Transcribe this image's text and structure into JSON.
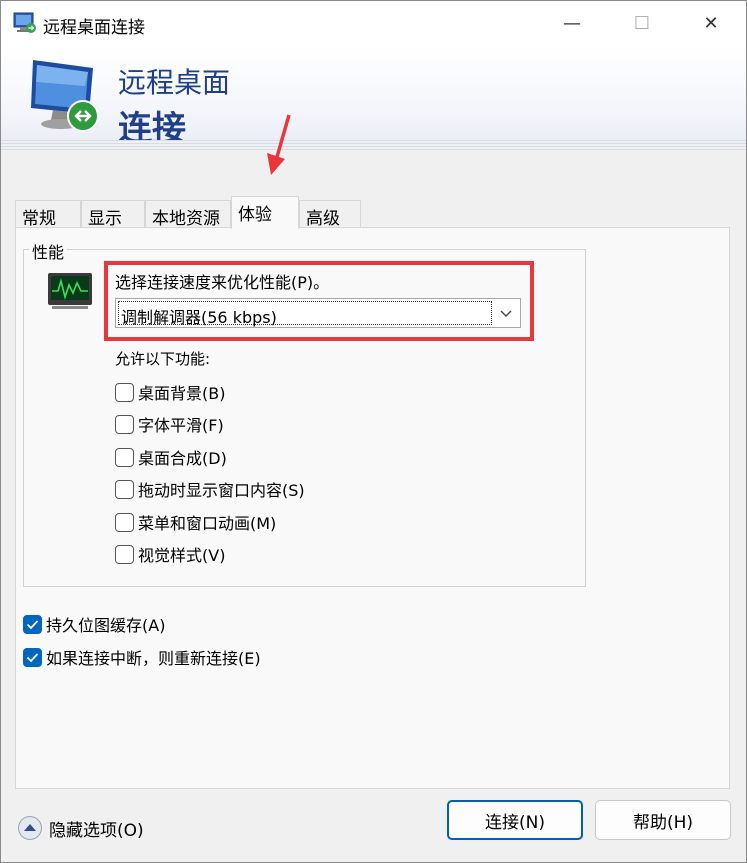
{
  "window": {
    "title": "远程桌面连接",
    "minimize_glyph": "—",
    "maximize_glyph": "☐",
    "close_glyph": "✕"
  },
  "banner": {
    "line1": "远程桌面",
    "line2": "连接"
  },
  "tabs": [
    {
      "label": "常规",
      "active": false
    },
    {
      "label": "显示",
      "active": false
    },
    {
      "label": "本地资源",
      "active": false
    },
    {
      "label": "体验",
      "active": true
    },
    {
      "label": "高级",
      "active": false
    }
  ],
  "performance": {
    "group_label": "性能",
    "speed_label": "选择连接速度来优化性能(P)。",
    "speed_selected": "调制解调器(56 kbps)",
    "allow_label": "允许以下功能:",
    "features": [
      {
        "label": "桌面背景(B)",
        "checked": false
      },
      {
        "label": "字体平滑(F)",
        "checked": false
      },
      {
        "label": "桌面合成(D)",
        "checked": false
      },
      {
        "label": "拖动时显示窗口内容(S)",
        "checked": false
      },
      {
        "label": "菜单和窗口动画(M)",
        "checked": false
      },
      {
        "label": "视觉样式(V)",
        "checked": false
      }
    ]
  },
  "options": [
    {
      "label": "持久位图缓存(A)",
      "checked": true
    },
    {
      "label": "如果连接中断，则重新连接(E)",
      "checked": true
    }
  ],
  "footer": {
    "hide_options_label": "隐藏选项(O)",
    "connect_label": "连接(N)",
    "help_label": "帮助(H)"
  },
  "colors": {
    "accent": "#0067c0",
    "highlight_red": "#e8383d",
    "banner_text": "#1f3f8b"
  }
}
